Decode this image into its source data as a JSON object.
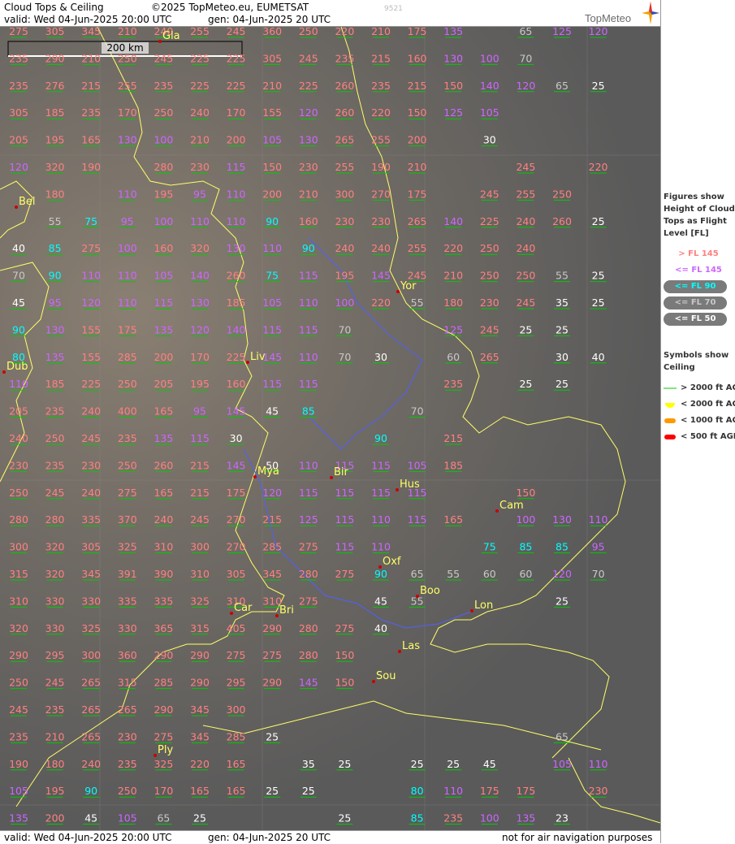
{
  "header": {
    "title": "Cloud Tops & Ceiling",
    "copyright": "©2025 TopMeteo.eu, EUMETSAT",
    "id_code": "9521",
    "valid": "valid:  Wed  04-Jun-2025  20:00 UTC",
    "generated": "gen: 04-Jun-2025 20 UTC",
    "logo": "TopMeteo"
  },
  "footer": {
    "valid": "valid:  Wed  04-Jun-2025  20:00 UTC",
    "generated": "gen: 04-Jun-2025 20 UTC",
    "disclaimer": "not for air navigation purposes"
  },
  "scale_bar": {
    "label": "200 km"
  },
  "legend": {
    "figures_title": "Figures show Height of Cloud Tops as Flight Level  [FL]",
    "levels": [
      {
        "label": "> FL 145",
        "color": "#ff8080"
      },
      {
        "label": "<= FL 145",
        "color": "#cc66ff"
      },
      {
        "label": "<= FL 90",
        "color": "#00ffff"
      },
      {
        "label": "<= FL 70",
        "color": "#c8c8c8"
      },
      {
        "label": "<= FL 50",
        "color": "#ffffff"
      }
    ],
    "symbols_title": "Symbols show Ceiling",
    "ceilings": [
      {
        "label": "> 2000 ft AGL",
        "color": "#00cc00"
      },
      {
        "label": "< 2000 ft AGL",
        "color": "#ffff00"
      },
      {
        "label": "< 1000 ft AGL",
        "color": "#ff9900"
      },
      {
        "label": "< 500 ft AGL",
        "color": "#ff0000"
      }
    ]
  },
  "cities": [
    {
      "name": "Gla"
    },
    {
      "name": "Bel"
    },
    {
      "name": "Yor"
    },
    {
      "name": "Liv"
    },
    {
      "name": "Dub"
    },
    {
      "name": "Mya"
    },
    {
      "name": "Bir"
    },
    {
      "name": "Hus"
    },
    {
      "name": "Cam"
    },
    {
      "name": "Oxf"
    },
    {
      "name": "Boo"
    },
    {
      "name": "Lon"
    },
    {
      "name": "Car"
    },
    {
      "name": "Bri"
    },
    {
      "name": "Las"
    },
    {
      "name": "Sou"
    },
    {
      "name": "Ply"
    }
  ],
  "map_data": {
    "rows": [
      [
        "275",
        "305",
        "345",
        "210",
        "240",
        "255",
        "245",
        "360",
        "250",
        "220",
        "210",
        "175",
        "135",
        "",
        "65",
        "125",
        "120"
      ],
      [
        "235",
        "290",
        "210",
        "250",
        "245",
        "225",
        "225",
        "305",
        "245",
        "235",
        "215",
        "160",
        "130",
        "100",
        "70",
        "",
        ""
      ],
      [
        "235",
        "276",
        "215",
        "255",
        "235",
        "225",
        "225",
        "210",
        "225",
        "260",
        "235",
        "215",
        "150",
        "140",
        "120",
        "65",
        "25"
      ],
      [
        "305",
        "185",
        "235",
        "170",
        "250",
        "240",
        "170",
        "155",
        "120",
        "260",
        "220",
        "150",
        "125",
        "105",
        "",
        "",
        ""
      ],
      [
        "205",
        "195",
        "165",
        "130",
        "100",
        "210",
        "200",
        "105",
        "130",
        "265",
        "255",
        "200",
        "",
        "30",
        "",
        "",
        ""
      ],
      [
        "120",
        "320",
        "190",
        "",
        "280",
        "230",
        "115",
        "150",
        "230",
        "255",
        "190",
        "210",
        "",
        "",
        "245",
        "",
        "220"
      ],
      [
        "",
        "180",
        "",
        "110",
        "195",
        "95",
        "110",
        "200",
        "210",
        "300",
        "270",
        "175",
        "",
        "245",
        "255",
        "250",
        ""
      ],
      [
        "",
        "55",
        "75",
        "95",
        "100",
        "110",
        "110",
        "90",
        "160",
        "230",
        "230",
        "265",
        "140",
        "225",
        "240",
        "260",
        "25"
      ],
      [
        "40",
        "85",
        "275",
        "100",
        "160",
        "320",
        "130",
        "110",
        "90",
        "240",
        "240",
        "255",
        "220",
        "250",
        "240",
        "",
        ""
      ],
      [
        "70",
        "90",
        "110",
        "110",
        "105",
        "140",
        "260",
        "75",
        "115",
        "195",
        "145",
        "245",
        "210",
        "250",
        "250",
        "55",
        "25"
      ],
      [
        "45",
        "95",
        "120",
        "110",
        "115",
        "130",
        "185",
        "105",
        "110",
        "100",
        "220",
        "55",
        "180",
        "230",
        "245",
        "35",
        "25"
      ],
      [
        "90",
        "130",
        "155",
        "175",
        "135",
        "120",
        "140",
        "115",
        "115",
        "70",
        "",
        "",
        "125",
        "245",
        "25",
        "25",
        ""
      ],
      [
        "80",
        "135",
        "155",
        "285",
        "200",
        "170",
        "225",
        "145",
        "110",
        "70",
        "30",
        "",
        "60",
        "265",
        "",
        "30",
        "40"
      ],
      [
        "110",
        "185",
        "225",
        "250",
        "205",
        "195",
        "160",
        "115",
        "115",
        "",
        "",
        "",
        "235",
        "",
        "25",
        "25",
        ""
      ],
      [
        "205",
        "235",
        "240",
        "400",
        "165",
        "95",
        "145",
        "45",
        "85",
        "",
        "",
        "70",
        "",
        "",
        "",
        "",
        ""
      ],
      [
        "240",
        "250",
        "245",
        "235",
        "135",
        "115",
        "30",
        "",
        "",
        "",
        "90",
        "",
        "215",
        "",
        "",
        "",
        ""
      ],
      [
        "230",
        "235",
        "230",
        "250",
        "260",
        "215",
        "145",
        "50",
        "110",
        "115",
        "115",
        "105",
        "185",
        "",
        "",
        "",
        ""
      ],
      [
        "250",
        "245",
        "240",
        "275",
        "165",
        "215",
        "175",
        "120",
        "115",
        "115",
        "115",
        "115",
        "",
        "",
        "150",
        "",
        ""
      ],
      [
        "280",
        "280",
        "335",
        "370",
        "240",
        "245",
        "270",
        "215",
        "125",
        "115",
        "110",
        "115",
        "165",
        "",
        "100",
        "130",
        "110"
      ],
      [
        "300",
        "320",
        "305",
        "325",
        "310",
        "300",
        "270",
        "285",
        "275",
        "115",
        "110",
        "",
        "",
        "75",
        "85",
        "85",
        "95"
      ],
      [
        "315",
        "320",
        "345",
        "391",
        "390",
        "310",
        "305",
        "345",
        "280",
        "275",
        "90",
        "65",
        "55",
        "60",
        "60",
        "120",
        "70"
      ],
      [
        "310",
        "330",
        "330",
        "335",
        "335",
        "325",
        "310",
        "310",
        "275",
        "",
        "45",
        "55",
        "",
        "",
        "",
        "25",
        ""
      ],
      [
        "320",
        "330",
        "325",
        "330",
        "365",
        "315",
        "405",
        "290",
        "280",
        "275",
        "40",
        "",
        "",
        "",
        "",
        "",
        ""
      ],
      [
        "290",
        "295",
        "300",
        "360",
        "290",
        "290",
        "275",
        "275",
        "280",
        "150",
        "",
        "",
        "",
        "",
        "",
        "",
        ""
      ],
      [
        "250",
        "245",
        "265",
        "315",
        "285",
        "290",
        "295",
        "290",
        "145",
        "150",
        "",
        "",
        "",
        "",
        "",
        "",
        ""
      ],
      [
        "245",
        "235",
        "265",
        "265",
        "290",
        "345",
        "300",
        "",
        "",
        "",
        "",
        "",
        "",
        "",
        "",
        "",
        ""
      ],
      [
        "235",
        "210",
        "265",
        "230",
        "275",
        "345",
        "285",
        "25",
        "",
        "",
        "",
        "",
        "",
        "",
        "",
        "65",
        ""
      ],
      [
        "190",
        "180",
        "240",
        "235",
        "325",
        "220",
        "165",
        "",
        "35",
        "25",
        "",
        "25",
        "25",
        "45",
        "",
        "105",
        "110"
      ],
      [
        "105",
        "195",
        "90",
        "250",
        "170",
        "165",
        "165",
        "25",
        "25",
        "",
        "",
        "80",
        "110",
        "175",
        "175",
        "",
        "230"
      ],
      [
        "135",
        "200",
        "45",
        "105",
        "65",
        "25",
        "",
        "",
        "",
        "25",
        "",
        "85",
        "235",
        "100",
        "135",
        "23",
        ""
      ]
    ]
  }
}
